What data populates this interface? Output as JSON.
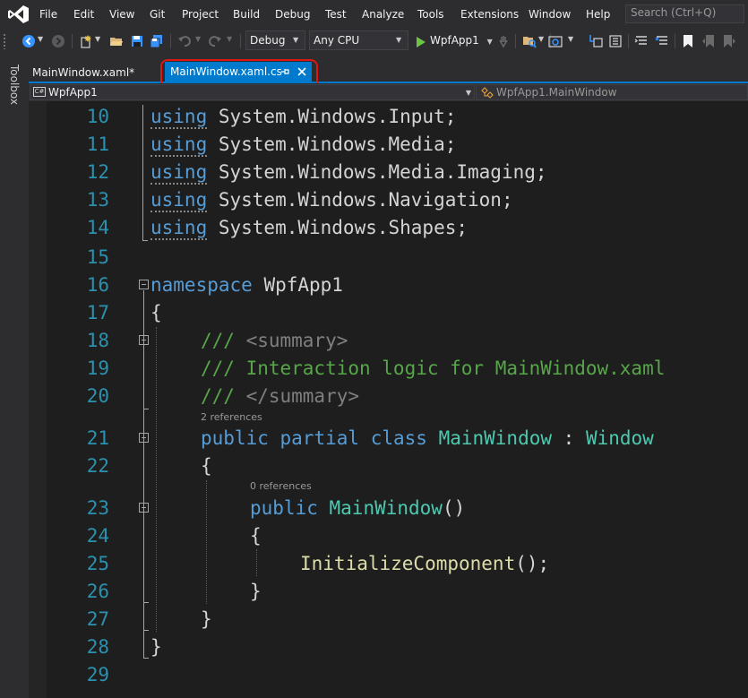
{
  "menu": {
    "items": [
      "File",
      "Edit",
      "View",
      "Git",
      "Project",
      "Build",
      "Debug",
      "Test",
      "Analyze",
      "Tools",
      "Extensions",
      "Window",
      "Help"
    ],
    "search_placeholder": "Search (Ctrl+Q)"
  },
  "toolbar": {
    "configuration": "Debug",
    "platform": "Any CPU",
    "run_target": "WpfApp1"
  },
  "toolbox": {
    "label": "Toolbox"
  },
  "tabs": [
    {
      "label": "MainWindow.xaml*",
      "active": false
    },
    {
      "label": "MainWindow.xaml.cs",
      "active": true
    }
  ],
  "navbar": {
    "project": "WpfApp1",
    "class": "WpfApp1.MainWindow"
  },
  "editor": {
    "lines": [
      {
        "number": "10",
        "tokens": [
          {
            "t": "using",
            "k": "kw"
          },
          {
            "t": " System.Windows.Input;",
            "k": "pl"
          }
        ]
      },
      {
        "number": "11",
        "tokens": [
          {
            "t": "using",
            "k": "kw"
          },
          {
            "t": " System.Windows.Media;",
            "k": "pl"
          }
        ]
      },
      {
        "number": "12",
        "tokens": [
          {
            "t": "using",
            "k": "kw"
          },
          {
            "t": " System.Windows.Media.Imaging;",
            "k": "pl"
          }
        ]
      },
      {
        "number": "13",
        "tokens": [
          {
            "t": "using",
            "k": "kw"
          },
          {
            "t": " System.Windows.Navigation;",
            "k": "pl"
          }
        ]
      },
      {
        "number": "14",
        "tokens": [
          {
            "t": "using",
            "k": "kw"
          },
          {
            "t": " System.Windows.Shapes;",
            "k": "pl"
          }
        ]
      },
      {
        "number": "15",
        "tokens": []
      },
      {
        "number": "16",
        "tokens": [
          {
            "t": "namespace",
            "k": "kw"
          },
          {
            "t": " WpfApp1",
            "k": "pl"
          }
        ]
      },
      {
        "number": "17",
        "tokens": [
          {
            "t": "{",
            "k": "pl"
          }
        ]
      },
      {
        "number": "18",
        "tokens": [
          {
            "t": "/// ",
            "k": "cm"
          },
          {
            "t": "<summary>",
            "k": "cmg"
          }
        ]
      },
      {
        "number": "19",
        "tokens": [
          {
            "t": "/// Interaction logic for MainWindow.xaml",
            "k": "cm"
          }
        ]
      },
      {
        "number": "20",
        "tokens": [
          {
            "t": "/// ",
            "k": "cm"
          },
          {
            "t": "</summary>",
            "k": "cmg"
          }
        ]
      },
      {
        "number": "21",
        "tokens": [
          {
            "t": "public",
            "k": "kw"
          },
          {
            "t": " ",
            "k": "pl"
          },
          {
            "t": "partial",
            "k": "kw"
          },
          {
            "t": " ",
            "k": "pl"
          },
          {
            "t": "class",
            "k": "kw"
          },
          {
            "t": " ",
            "k": "pl"
          },
          {
            "t": "MainWindow",
            "k": "ty"
          },
          {
            "t": " : ",
            "k": "pl"
          },
          {
            "t": "Window",
            "k": "ty"
          }
        ]
      },
      {
        "number": "22",
        "tokens": [
          {
            "t": "{",
            "k": "pl"
          }
        ]
      },
      {
        "number": "23",
        "tokens": [
          {
            "t": "public",
            "k": "kw"
          },
          {
            "t": " ",
            "k": "pl"
          },
          {
            "t": "MainWindow",
            "k": "ty"
          },
          {
            "t": "()",
            "k": "pl"
          }
        ]
      },
      {
        "number": "24",
        "tokens": [
          {
            "t": "{",
            "k": "pl"
          }
        ]
      },
      {
        "number": "25",
        "tokens": [
          {
            "t": "InitializeComponent",
            "k": "fn"
          },
          {
            "t": "();",
            "k": "pl"
          }
        ]
      },
      {
        "number": "26",
        "tokens": [
          {
            "t": "}",
            "k": "pl"
          }
        ]
      },
      {
        "number": "27",
        "tokens": [
          {
            "t": "}",
            "k": "pl"
          }
        ]
      },
      {
        "number": "28",
        "tokens": [
          {
            "t": "}",
            "k": "pl"
          }
        ]
      },
      {
        "number": "29",
        "tokens": []
      }
    ],
    "codelens": {
      "class_refs": "2 references",
      "ctor_refs": "0 references"
    }
  },
  "colors": {
    "accent": "#007acc",
    "highlight_ring": "#e01515",
    "keyword": "#569cd6",
    "type": "#4ec9b0",
    "comment": "#57a64a",
    "line_number": "#2b91af"
  }
}
